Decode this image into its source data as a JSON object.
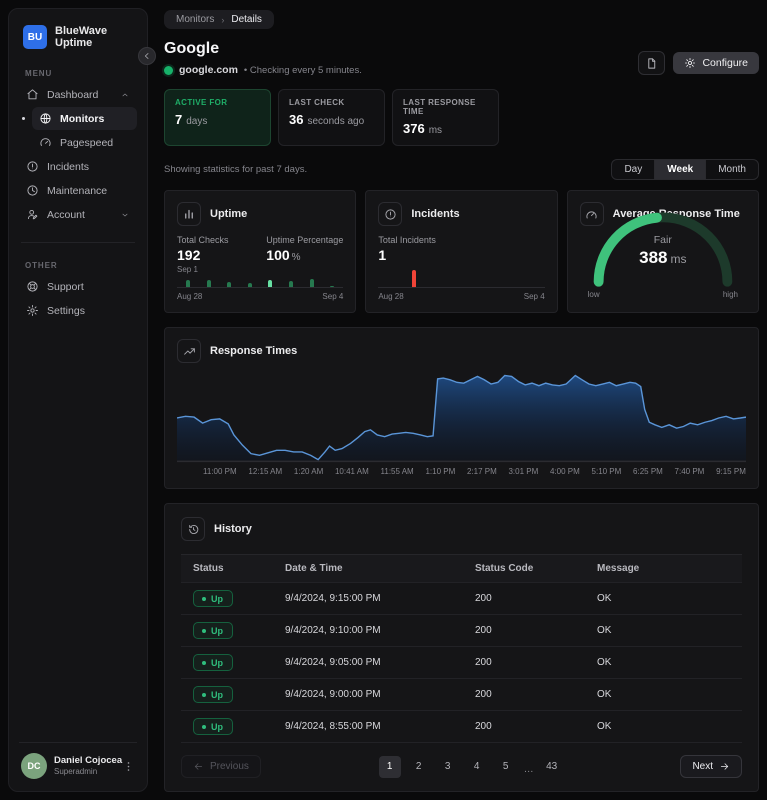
{
  "colors": {
    "success": "#17b26a",
    "error": "#f04438",
    "chart_line": "#5a95d8",
    "bar_green": "#26794f",
    "bar_green_highlight": "#67e0a3",
    "gauge_green": "#3fc27c",
    "gauge_track": "#1d3a2b"
  },
  "sidebar": {
    "brand": {
      "initials": "BU",
      "name": "BlueWave Uptime"
    },
    "sections": [
      {
        "label": "MENU",
        "items": [
          {
            "label": "Dashboard",
            "icon": "home-icon",
            "chevron": "up"
          },
          {
            "label": "Monitors",
            "icon": "globe-icon",
            "child": true,
            "active": true
          },
          {
            "label": "Pagespeed",
            "icon": "speedometer-icon",
            "child": true
          },
          {
            "label": "Incidents",
            "icon": "alert-circle-icon"
          },
          {
            "label": "Maintenance",
            "icon": "clock-icon"
          },
          {
            "label": "Account",
            "icon": "user-icon",
            "chevron": "down"
          }
        ]
      },
      {
        "label": "OTHER",
        "items": [
          {
            "label": "Support",
            "icon": "help-circle-icon"
          },
          {
            "label": "Settings",
            "icon": "gear-icon"
          }
        ]
      }
    ],
    "user": {
      "initials": "DC",
      "name": "Daniel Cojocea",
      "role": "Superadmin"
    }
  },
  "header": {
    "breadcrumb": [
      "Monitors",
      "Details"
    ],
    "title": "Google",
    "url": "google.com",
    "note": "• Checking every 5 minutes.",
    "configure_label": "Configure"
  },
  "stat_cards": [
    {
      "label": "ACTIVE FOR",
      "value": "7",
      "unit": "days",
      "variant": "success"
    },
    {
      "label": "LAST CHECK",
      "value": "36",
      "unit": "seconds ago",
      "variant": "default"
    },
    {
      "label": "LAST RESPONSE TIME",
      "value": "376",
      "unit": "ms",
      "variant": "default"
    }
  ],
  "stats_note": "Showing statistics for past 7 days.",
  "range_toggle": {
    "options": [
      "Day",
      "Week",
      "Month"
    ],
    "selected": "Week"
  },
  "uptime_card": {
    "title": "Uptime",
    "total_checks_label": "Total Checks",
    "total_checks": "192",
    "hover_date": "Sep 1",
    "uptime_label": "Uptime Percentage",
    "uptime_value": "100",
    "uptime_unit": "%",
    "x_start": "Aug 28",
    "x_end": "Sep 4"
  },
  "incidents_card": {
    "title": "Incidents",
    "total_label": "Total Incidents",
    "total": "1",
    "x_start": "Aug 28",
    "x_end": "Sep 4"
  },
  "gauge_card": {
    "title": "Average Response Time",
    "status": "Fair",
    "value": "388",
    "unit": "ms",
    "low": "low",
    "high": "high"
  },
  "response_card": {
    "title": "Response Times"
  },
  "history": {
    "title": "History",
    "columns": [
      "Status",
      "Date & Time",
      "Status Code",
      "Message"
    ],
    "rows": [
      {
        "status": "Up",
        "datetime": "9/4/2024, 9:15:00 PM",
        "code": "200",
        "message": "OK"
      },
      {
        "status": "Up",
        "datetime": "9/4/2024, 9:10:00 PM",
        "code": "200",
        "message": "OK"
      },
      {
        "status": "Up",
        "datetime": "9/4/2024, 9:05:00 PM",
        "code": "200",
        "message": "OK"
      },
      {
        "status": "Up",
        "datetime": "9/4/2024, 9:00:00 PM",
        "code": "200",
        "message": "OK"
      },
      {
        "status": "Up",
        "datetime": "9/4/2024, 8:55:00 PM",
        "code": "200",
        "message": "OK"
      }
    ],
    "pagination": {
      "previous": "Previous",
      "next": "Next",
      "pages": [
        "1",
        "2",
        "3",
        "4",
        "5",
        "...",
        "43"
      ],
      "current": "1"
    }
  },
  "chart_data": [
    {
      "id": "uptime-bars",
      "type": "bar",
      "title": "Uptime checks per day",
      "x_range": [
        "Aug 28",
        "Sep 4"
      ],
      "values_relative": [
        0.77,
        0.81,
        0.6,
        0.49,
        0.81,
        0.62,
        0.84,
        0.08
      ],
      "highlight_index": 4,
      "highlight_label": "Sep 1",
      "totals": {
        "total_checks": 192,
        "uptime_percentage": 100
      }
    },
    {
      "id": "incidents-bar",
      "type": "bar",
      "title": "Incidents per day",
      "x_range": [
        "Aug 28",
        "Sep 4"
      ],
      "positions_fraction": [
        0.2
      ],
      "values_relative": [
        0.85
      ],
      "total_incidents": 1
    },
    {
      "id": "response-gauge",
      "type": "gauge",
      "title": "Average Response Time",
      "value_ms": 388,
      "status": "Fair",
      "fill_fraction": 0.47,
      "scale": [
        "low",
        "high"
      ]
    },
    {
      "id": "response-times",
      "type": "area",
      "title": "Response Times",
      "x_labels": [
        "11:00 PM",
        "12:15 AM",
        "1:20 AM",
        "10:41 AM",
        "11:55 AM",
        "1:10 PM",
        "2:17 PM",
        "3:01 PM",
        "4:00 PM",
        "5:10 PM",
        "6:25 PM",
        "7:40 PM",
        "9:15 PM"
      ],
      "points_relative": [
        [
          0,
          0.5
        ],
        [
          0.015,
          0.52
        ],
        [
          0.03,
          0.51
        ],
        [
          0.045,
          0.44
        ],
        [
          0.06,
          0.48
        ],
        [
          0.075,
          0.49
        ],
        [
          0.09,
          0.43
        ],
        [
          0.1,
          0.3
        ],
        [
          0.115,
          0.18
        ],
        [
          0.13,
          0.08
        ],
        [
          0.145,
          0.06
        ],
        [
          0.16,
          0.09
        ],
        [
          0.175,
          0.12
        ],
        [
          0.19,
          0.12
        ],
        [
          0.205,
          0.1
        ],
        [
          0.22,
          0.1
        ],
        [
          0.235,
          0.06
        ],
        [
          0.248,
          0.01
        ],
        [
          0.26,
          0.1
        ],
        [
          0.268,
          0.17
        ],
        [
          0.278,
          0.12
        ],
        [
          0.29,
          0.14
        ],
        [
          0.305,
          0.2
        ],
        [
          0.318,
          0.27
        ],
        [
          0.33,
          0.34
        ],
        [
          0.34,
          0.36
        ],
        [
          0.352,
          0.3
        ],
        [
          0.365,
          0.28
        ],
        [
          0.378,
          0.31
        ],
        [
          0.39,
          0.32
        ],
        [
          0.402,
          0.33
        ],
        [
          0.415,
          0.32
        ],
        [
          0.428,
          0.3
        ],
        [
          0.44,
          0.28
        ],
        [
          0.45,
          0.29
        ],
        [
          0.458,
          0.96
        ],
        [
          0.468,
          0.97
        ],
        [
          0.48,
          0.95
        ],
        [
          0.492,
          0.92
        ],
        [
          0.504,
          0.91
        ],
        [
          0.516,
          0.95
        ],
        [
          0.528,
          0.99
        ],
        [
          0.54,
          0.95
        ],
        [
          0.552,
          0.9
        ],
        [
          0.564,
          0.92
        ],
        [
          0.576,
          1.0
        ],
        [
          0.588,
          0.99
        ],
        [
          0.6,
          0.93
        ],
        [
          0.612,
          0.89
        ],
        [
          0.624,
          0.91
        ],
        [
          0.636,
          0.88
        ],
        [
          0.648,
          0.91
        ],
        [
          0.66,
          0.89
        ],
        [
          0.672,
          0.88
        ],
        [
          0.684,
          0.9
        ],
        [
          0.7,
          1.0
        ],
        [
          0.712,
          0.95
        ],
        [
          0.724,
          0.9
        ],
        [
          0.736,
          0.88
        ],
        [
          0.748,
          0.9
        ],
        [
          0.76,
          0.92
        ],
        [
          0.772,
          0.88
        ],
        [
          0.784,
          0.9
        ],
        [
          0.796,
          0.92
        ],
        [
          0.806,
          0.91
        ],
        [
          0.815,
          0.87
        ],
        [
          0.822,
          0.6
        ],
        [
          0.83,
          0.45
        ],
        [
          0.84,
          0.42
        ],
        [
          0.852,
          0.39
        ],
        [
          0.865,
          0.42
        ],
        [
          0.878,
          0.38
        ],
        [
          0.89,
          0.4
        ],
        [
          0.902,
          0.44
        ],
        [
          0.915,
          0.42
        ],
        [
          0.928,
          0.45
        ],
        [
          0.94,
          0.47
        ],
        [
          0.952,
          0.5
        ],
        [
          0.965,
          0.52
        ],
        [
          0.978,
          0.49
        ],
        [
          0.99,
          0.5
        ],
        [
          1,
          0.51
        ]
      ]
    }
  ]
}
